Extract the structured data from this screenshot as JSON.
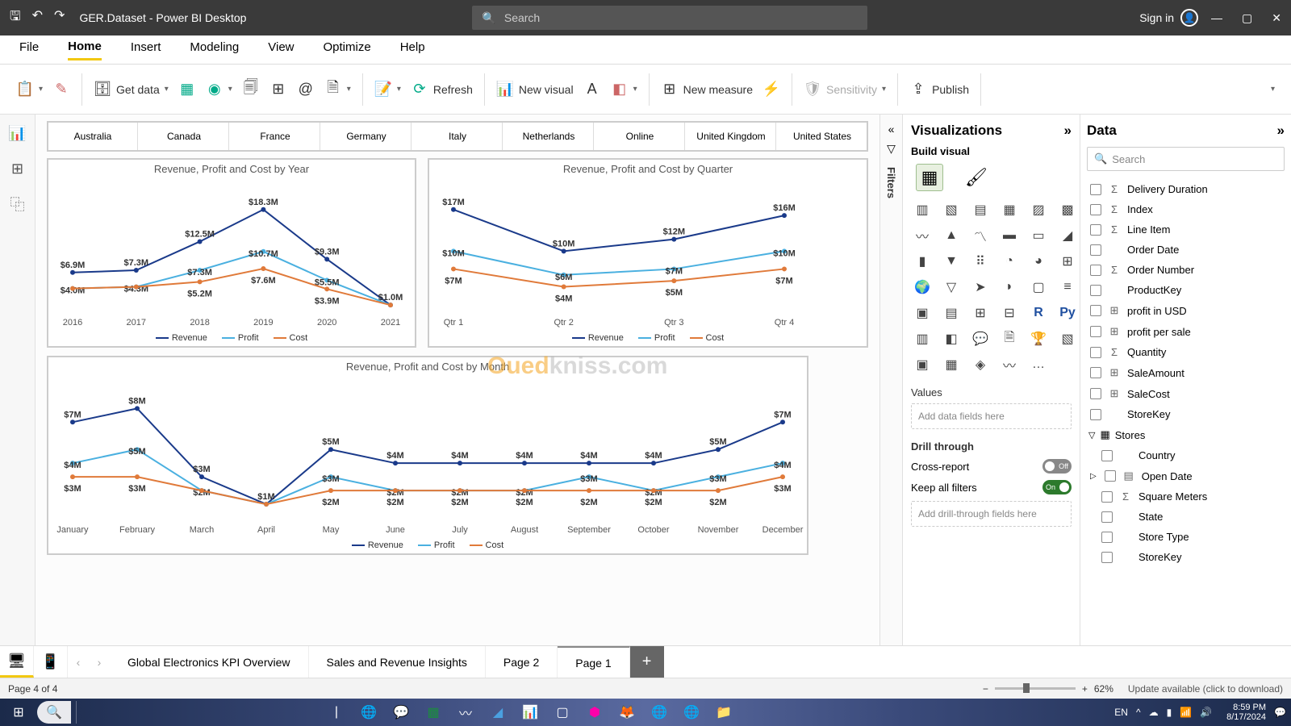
{
  "titlebar": {
    "title": "GER.Dataset - Power BI Desktop",
    "search_placeholder": "Search",
    "signin": "Sign in"
  },
  "ribbon_tabs": [
    "File",
    "Home",
    "Insert",
    "Modeling",
    "View",
    "Optimize",
    "Help"
  ],
  "ribbon_buttons": {
    "get_data": "Get data",
    "refresh": "Refresh",
    "new_visual": "New visual",
    "new_measure": "New measure",
    "sensitivity": "Sensitivity",
    "publish": "Publish"
  },
  "slicer": [
    "Australia",
    "Canada",
    "France",
    "Germany",
    "Italy",
    "Netherlands",
    "Online",
    "United Kingdom",
    "United States"
  ],
  "charts": {
    "year": {
      "title": "Revenue, Profit and Cost by Year"
    },
    "quarter": {
      "title": "Revenue, Profit and Cost by Quarter"
    },
    "month": {
      "title": "Revenue, Profit and Cost by Month"
    },
    "legend": [
      "Revenue",
      "Profit",
      "Cost"
    ]
  },
  "viz_pane": {
    "title": "Visualizations",
    "subtitle": "Build visual",
    "values": "Values",
    "values_drop": "Add data fields here",
    "drill": "Drill through",
    "cross": "Cross-report",
    "keep": "Keep all filters",
    "drill_drop": "Add drill-through fields here",
    "off": "Off",
    "on": "On"
  },
  "data_pane": {
    "title": "Data",
    "search_placeholder": "Search",
    "fields": [
      {
        "icon": "Σ",
        "label": "Delivery Duration"
      },
      {
        "icon": "Σ",
        "label": "Index"
      },
      {
        "icon": "Σ",
        "label": "Line Item"
      },
      {
        "icon": "",
        "label": "Order Date"
      },
      {
        "icon": "Σ",
        "label": "Order Number"
      },
      {
        "icon": "",
        "label": "ProductKey"
      },
      {
        "icon": "⊞",
        "label": "profit in USD"
      },
      {
        "icon": "⊞",
        "label": "profit per sale"
      },
      {
        "icon": "Σ",
        "label": "Quantity"
      },
      {
        "icon": "⊞",
        "label": "SaleAmount"
      },
      {
        "icon": "⊞",
        "label": "SaleCost"
      },
      {
        "icon": "",
        "label": "StoreKey"
      }
    ],
    "table2": "Stores",
    "fields2": [
      {
        "icon": "",
        "label": "Country",
        "indent": true
      },
      {
        "icon": "▤",
        "label": "Open Date",
        "indent": true,
        "expand": true
      },
      {
        "icon": "Σ",
        "label": "Square Meters",
        "indent": true
      },
      {
        "icon": "",
        "label": "State",
        "indent": true
      },
      {
        "icon": "",
        "label": "Store Type",
        "indent": true
      },
      {
        "icon": "",
        "label": "StoreKey",
        "indent": true
      }
    ]
  },
  "filters_label": "Filters",
  "page_tabs": [
    "Global Electronics KPI Overview",
    "Sales and Revenue Insights",
    "Page 2",
    "Page 1"
  ],
  "status": {
    "page": "Page 4 of 4",
    "zoom": "62%",
    "update": "Update available (click to download)"
  },
  "taskbar": {
    "lang": "EN",
    "time": "8:59 PM",
    "date": "8/17/2024"
  },
  "chart_data": [
    {
      "type": "line",
      "title": "Revenue, Profit and Cost by Year",
      "categories": [
        "2016",
        "2017",
        "2018",
        "2019",
        "2020",
        "2021"
      ],
      "series": [
        {
          "name": "Revenue",
          "values": [
            6.9,
            7.3,
            12.5,
            18.3,
            9.3,
            1.0
          ],
          "labels": [
            "$6.9M",
            "$7.3M",
            "$12.5M",
            "$18.3M",
            "$9.3M",
            "$1.0M"
          ]
        },
        {
          "name": "Profit",
          "values": [
            4.0,
            4.3,
            7.3,
            10.7,
            5.5,
            1.0
          ],
          "labels": [
            "$4.0M",
            "$4.3M",
            "$7.3M",
            "$10.7M",
            "$5.5M",
            ""
          ]
        },
        {
          "name": "Cost",
          "values": [
            4.0,
            4.3,
            5.2,
            7.6,
            3.9,
            1.0
          ],
          "labels": [
            "",
            "",
            "$5.2M",
            "$7.6M",
            "$3.9M",
            ""
          ]
        }
      ],
      "ylabel": "",
      "xlabel": ""
    },
    {
      "type": "line",
      "title": "Revenue, Profit and Cost by Quarter",
      "categories": [
        "Qtr 1",
        "Qtr 2",
        "Qtr 3",
        "Qtr 4"
      ],
      "series": [
        {
          "name": "Revenue",
          "values": [
            17,
            10,
            12,
            16
          ],
          "labels": [
            "$17M",
            "$10M",
            "$12M",
            "$16M"
          ]
        },
        {
          "name": "Profit",
          "values": [
            10,
            6,
            7,
            10
          ],
          "labels": [
            "$10M",
            "$6M",
            "$7M",
            "$10M"
          ]
        },
        {
          "name": "Cost",
          "values": [
            7,
            4,
            5,
            7
          ],
          "labels": [
            "$7M",
            "$4M",
            "$5M",
            "$7M"
          ]
        }
      ]
    },
    {
      "type": "line",
      "title": "Revenue, Profit and Cost by Month",
      "categories": [
        "January",
        "February",
        "March",
        "April",
        "May",
        "June",
        "July",
        "August",
        "September",
        "October",
        "November",
        "December"
      ],
      "series": [
        {
          "name": "Revenue",
          "values": [
            7,
            8,
            3,
            1,
            5,
            4,
            4,
            4,
            4,
            4,
            5,
            7
          ],
          "labels": [
            "$7M",
            "$8M",
            "$3M",
            "$1M",
            "$5M",
            "$4M",
            "$4M",
            "$4M",
            "$4M",
            "$4M",
            "$5M",
            "$7M"
          ]
        },
        {
          "name": "Profit",
          "values": [
            4,
            5,
            2,
            1,
            3,
            2,
            2,
            2,
            3,
            2,
            3,
            4
          ],
          "labels": [
            "$4M",
            "$5M",
            "$2M",
            "",
            "$3M",
            "$2M",
            "$2M",
            "$2M",
            "$3M",
            "$2M",
            "$3M",
            "$4M"
          ]
        },
        {
          "name": "Cost",
          "values": [
            3,
            3,
            2,
            1,
            2,
            2,
            2,
            2,
            2,
            2,
            2,
            3
          ],
          "labels": [
            "$3M",
            "$3M",
            "",
            "",
            "$2M",
            "$2M",
            "$2M",
            "$2M",
            "$2M",
            "$2M",
            "$2M",
            "$3M"
          ]
        }
      ]
    }
  ]
}
